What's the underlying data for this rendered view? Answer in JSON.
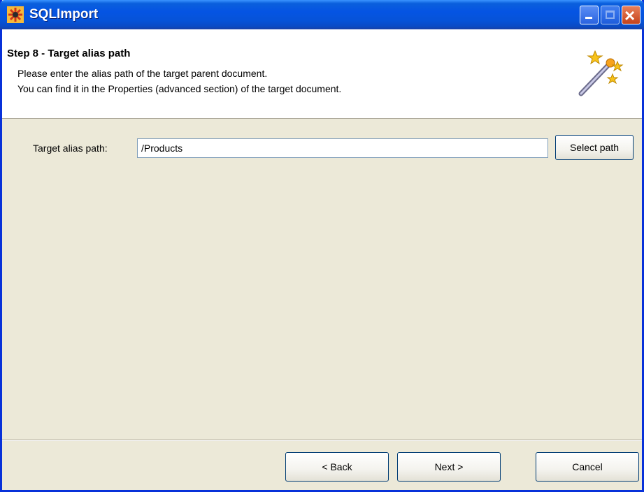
{
  "window": {
    "title": "SQLImport",
    "controls": {
      "minimize": "minimize",
      "maximize": "maximize",
      "close": "close"
    }
  },
  "header": {
    "step_title": "Step 8 - Target alias path",
    "description_line1": "Please enter the alias path of the target parent document.",
    "description_line2": "You can find it in the Properties (advanced section) of the target document.",
    "icon": "magic-wand-icon"
  },
  "form": {
    "target_alias_label": "Target alias path:",
    "target_alias_value": "/Products",
    "select_path_label": "Select path"
  },
  "footer": {
    "back_label": "< Back",
    "next_label": "Next >",
    "cancel_label": "Cancel"
  },
  "colors": {
    "titlebar": "#0554e3",
    "dialog_background": "#ece9d8",
    "header_background": "#ffffff",
    "close_button": "#c5421b"
  }
}
